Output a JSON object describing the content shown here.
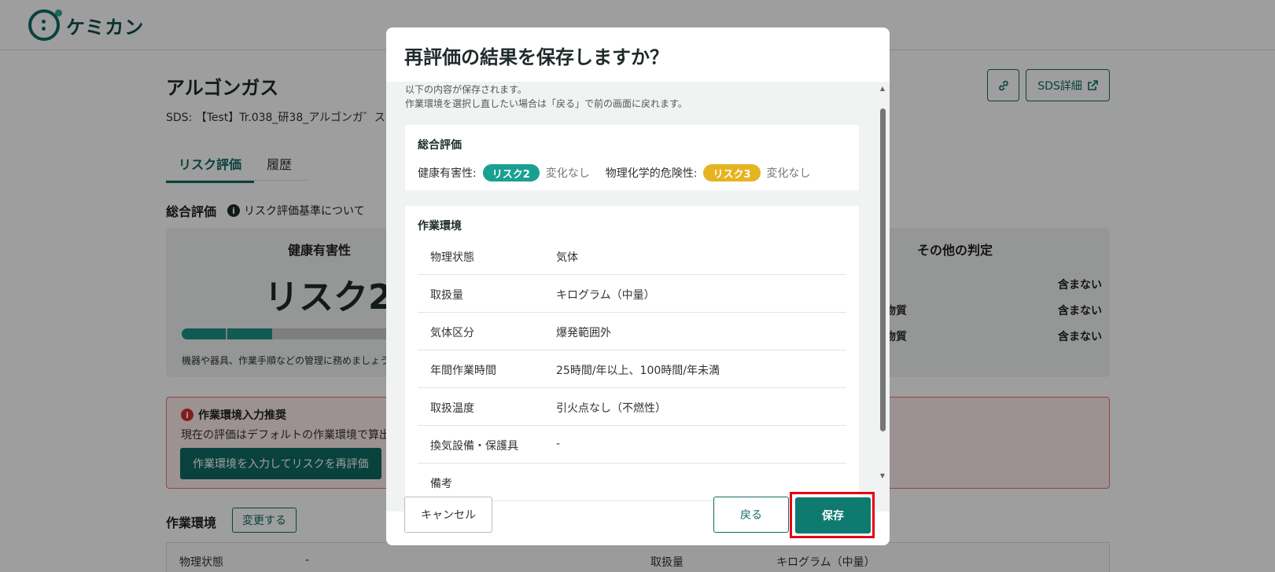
{
  "app": {
    "logo_text": "ケミカン"
  },
  "page": {
    "title": "アルゴンガス",
    "sds_line": "SDS: 【Test】Tr.038_研38_アルゴンガ゛ス",
    "sds_button": "SDS詳細",
    "tabs": [
      "リスク評価",
      "履歴"
    ],
    "overall_heading": "総合評価",
    "overall_info": "リスク評価基準について",
    "health_heading": "健康有害性",
    "health_risk": "リスク2",
    "health_risk_level": 2,
    "health_risk_max": 5,
    "health_note": "機器や器具、作業手順などの管理に務めましょう",
    "other_heading": "その他の判定",
    "other_rows": [
      {
        "label": "",
        "value": "含まない"
      },
      {
        "label": "定物質",
        "value": "含まない"
      },
      {
        "label": "学物質",
        "value": "含まない"
      }
    ],
    "alert": {
      "title": "作業環境入力推奨",
      "body": "現在の評価はデフォルトの作業環境で算出",
      "button": "作業環境を入力してリスクを再評価"
    },
    "env_heading": "作業環境",
    "env_change": "変更する",
    "env_table": {
      "k1": "物理状態",
      "v1": "-",
      "k2": "取扱量",
      "v2": "キログラム（中量）"
    }
  },
  "modal": {
    "title": "再評価の結果を保存しますか？",
    "intro_1": "以下の内容が保存されます。",
    "intro_2": "作業環境を選択し直したい場合は「戻る」で前の画面に戻れます。",
    "overall": {
      "heading": "総合評価",
      "health_label": "健康有害性:",
      "health_pill": "リスク2",
      "health_change": "変化なし",
      "phys_label": "物理化学的危険性:",
      "phys_pill": "リスク3",
      "phys_change": "変化なし",
      "colors": {
        "health": "#1aa091",
        "phys": "#e6b422"
      }
    },
    "env": {
      "heading": "作業環境",
      "rows": [
        {
          "key": "物理状態",
          "value": "気体"
        },
        {
          "key": "取扱量",
          "value": "キログラム（中量）"
        },
        {
          "key": "気体区分",
          "value": "爆発範囲外"
        },
        {
          "key": "年間作業時間",
          "value": "25時間/年以上、100時間/年未満"
        },
        {
          "key": "取扱温度",
          "value": "引火点なし（不燃性）"
        },
        {
          "key": "換気設備・保護具",
          "value": "-"
        },
        {
          "key": "備考",
          "value": ""
        }
      ]
    },
    "buttons": {
      "cancel": "キャンセル",
      "back": "戻る",
      "save": "保存"
    },
    "highlight_color": "#e60012"
  }
}
